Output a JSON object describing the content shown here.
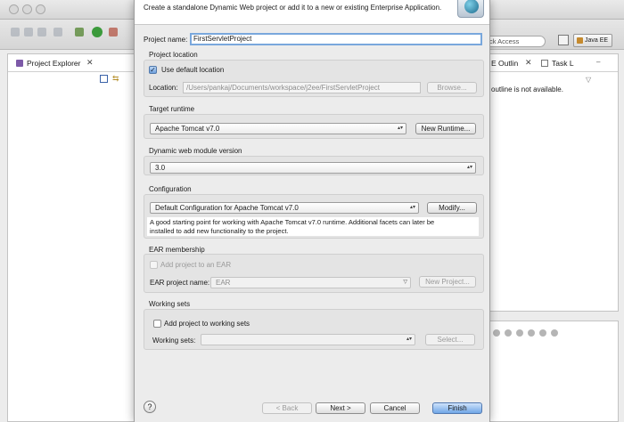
{
  "ide": {
    "quick_access_placeholder": "ck Access",
    "perspective_label": "Java EE",
    "project_explorer_label": "Project Explorer",
    "outline_label": "E Outlin",
    "task_list_label": "Task L",
    "outline_message": "outline is not available.",
    "close_glyph": "✕",
    "link_glyph": "⇆",
    "minimize_glyph": "–",
    "menu_glyph": "▽"
  },
  "dialog": {
    "description": "Create a standalone Dynamic Web project or add it to a new or existing Enterprise Application.",
    "project_name_label": "Project name:",
    "project_name_value": "FirstServletProject",
    "project_location": {
      "title": "Project location",
      "use_default_label": "Use default location",
      "use_default_checked": true,
      "location_label": "Location:",
      "location_value": "/Users/pankaj/Documents/workspace/j2ee/FirstServletProject",
      "browse_label": "Browse..."
    },
    "target_runtime": {
      "title": "Target runtime",
      "selected": "Apache Tomcat v7.0",
      "new_runtime_label": "New Runtime..."
    },
    "web_module": {
      "title": "Dynamic web module version",
      "selected": "3.0"
    },
    "configuration": {
      "title": "Configuration",
      "selected": "Default Configuration for Apache Tomcat v7.0",
      "modify_label": "Modify...",
      "description_line1": "A good starting point for working with Apache Tomcat v7.0 runtime. Additional facets can later be",
      "description_line2": "installed to add new functionality to the project."
    },
    "ear": {
      "title": "EAR membership",
      "add_label": "Add project to an EAR",
      "project_name_label": "EAR project name:",
      "project_name_value": "EAR",
      "new_project_label": "New Project..."
    },
    "working_sets": {
      "title": "Working sets",
      "add_label": "Add project to working sets",
      "sets_label": "Working sets:",
      "sets_value": "",
      "select_label": "Select..."
    },
    "footer": {
      "help_glyph": "?",
      "back_label": "< Back",
      "next_label": "Next >",
      "cancel_label": "Cancel",
      "finish_label": "Finish"
    },
    "check_glyph": "✓",
    "combo_arrow_glyph": "▴▾"
  }
}
